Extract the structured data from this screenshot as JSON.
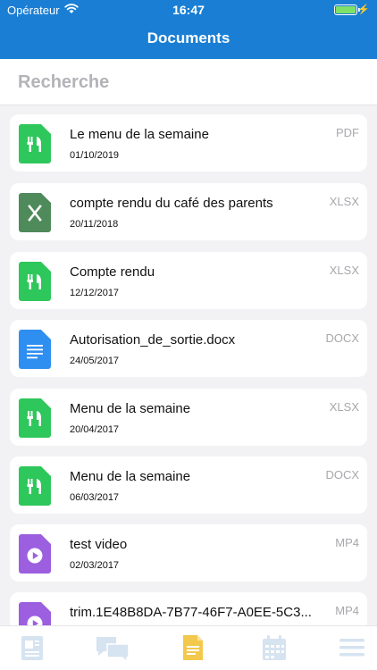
{
  "status_bar": {
    "carrier": "Opérateur",
    "time": "16:47"
  },
  "header": {
    "title": "Documents"
  },
  "search": {
    "placeholder": "Recherche"
  },
  "documents": [
    {
      "name": "Le menu de la semaine",
      "date": "01/10/2019",
      "type": "PDF",
      "icon": "fork-knife-icon"
    },
    {
      "name": "compte rendu du café des parents",
      "date": "20/11/2018",
      "type": "XLSX",
      "icon": "excel-icon"
    },
    {
      "name": "Compte rendu",
      "date": "12/12/2017",
      "type": "XLSX",
      "icon": "fork-knife-icon"
    },
    {
      "name": "Autorisation_de_sortie.docx",
      "date": "24/05/2017",
      "type": "DOCX",
      "icon": "word-doc-icon"
    },
    {
      "name": "Menu de la semaine",
      "date": "20/04/2017",
      "type": "XLSX",
      "icon": "fork-knife-icon"
    },
    {
      "name": "Menu de la semaine",
      "date": "06/03/2017",
      "type": "DOCX",
      "icon": "fork-knife-icon"
    },
    {
      "name": "test video",
      "date": "02/03/2017",
      "type": "MP4",
      "icon": "video-play-icon"
    },
    {
      "name": "trim.1E48B8DA-7B77-46F7-A0EE-5C3...",
      "date": "",
      "type": "MP4",
      "icon": "video-play-icon"
    }
  ],
  "tabs": [
    {
      "icon": "news-icon",
      "active": false
    },
    {
      "icon": "chat-bubbles-icon",
      "active": false
    },
    {
      "icon": "document-icon",
      "active": true
    },
    {
      "icon": "calendar-icon",
      "active": false
    },
    {
      "icon": "menu-icon",
      "active": false
    }
  ],
  "colors": {
    "primary": "#1a7fd4",
    "food_green": "#2ec75b",
    "excel_green": "#4f8a5b",
    "word_blue": "#2f8ff0",
    "video_purple": "#9b5fe0",
    "tab_inactive": "#d6e3f0",
    "tab_active": "#f2c94c"
  }
}
